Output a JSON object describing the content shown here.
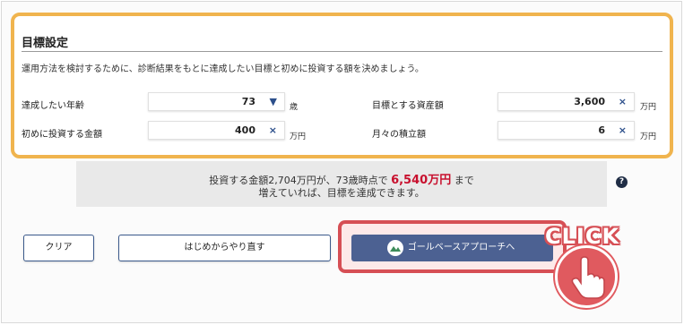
{
  "goal": {
    "title": "目標設定",
    "description": "運用方法を検討するために、診断結果をもとに達成したい目標と初めに投資する額を決めましょう。",
    "fields": [
      {
        "label": "達成したい年齢",
        "value": "73",
        "icon": "chevron-down-icon",
        "unit": "歳"
      },
      {
        "label": "目標とする資産額",
        "value": "3,600",
        "icon": "clear-icon",
        "unit": "万円"
      },
      {
        "label": "初めに投資する金額",
        "value": "400",
        "icon": "clear-icon",
        "unit": "万円"
      },
      {
        "label": "月々の積立額",
        "value": "6",
        "icon": "clear-icon",
        "unit": "万円"
      }
    ]
  },
  "result": {
    "line1_prefix": "投資する金額2,704万円が、73歳時点で",
    "amount": "6,540万円",
    "line1_suffix": "まで",
    "line2": "増えていれば、目標を達成できます。",
    "help": "?"
  },
  "actions": {
    "clear_label": "クリア",
    "restart_label": "はじめからやり直す",
    "primary_label": "ゴールベースアプローチへ"
  },
  "overlay": {
    "click_text": "CLICK"
  },
  "colors": {
    "panel_border": "#f0b44e",
    "highlight": "#d64f55",
    "primary_button": "#4c6192",
    "amount": "#c8102e"
  }
}
